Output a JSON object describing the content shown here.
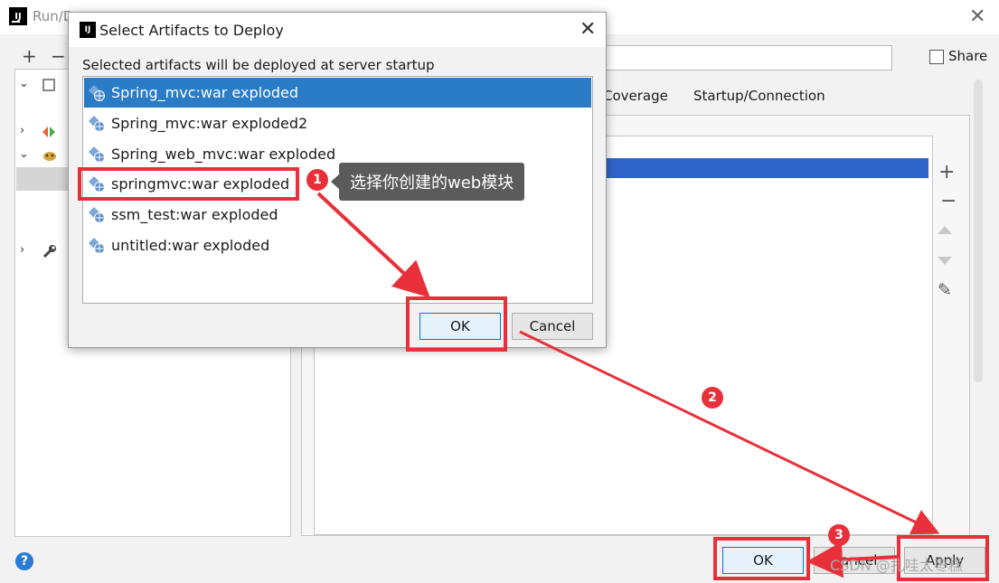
{
  "background_window": {
    "title": "Run/D",
    "logo_text": "IJ",
    "close_glyph": "✕",
    "toolbar": {
      "add": "+",
      "remove": "−"
    },
    "share_label": "Share",
    "tabs": [
      "Coverage",
      "Startup/Connection"
    ],
    "side_tools": {
      "add": "+",
      "remove": "−",
      "edit": "✎"
    },
    "help_glyph": "?",
    "buttons": {
      "ok": "OK",
      "cancel": "Cancel",
      "apply": "Apply"
    },
    "watermark": "CSDN @扎哇太枣糕"
  },
  "dialog": {
    "title": "Select Artifacts to Deploy",
    "logo_text": "IJ",
    "close_glyph": "✕",
    "label": "Selected artifacts will be deployed at server startup",
    "artifacts": [
      {
        "label": "Spring_mvc:war exploded",
        "selected": true
      },
      {
        "label": "Spring_mvc:war exploded2",
        "selected": false
      },
      {
        "label": "Spring_web_mvc:war exploded",
        "selected": false
      },
      {
        "label": "springmvc:war exploded",
        "selected": false
      },
      {
        "label": "ssm_test:war exploded",
        "selected": false
      },
      {
        "label": "untitled:war exploded",
        "selected": false
      }
    ],
    "ok_label": "OK",
    "cancel_label": "Cancel"
  },
  "annotations": {
    "tooltip": "选择你创建的web模块",
    "badges": [
      "1",
      "2",
      "3"
    ],
    "color": "#e8303a"
  },
  "colors": {
    "selection": "#2a7cc7",
    "accent_button_border": "#0078d7"
  }
}
